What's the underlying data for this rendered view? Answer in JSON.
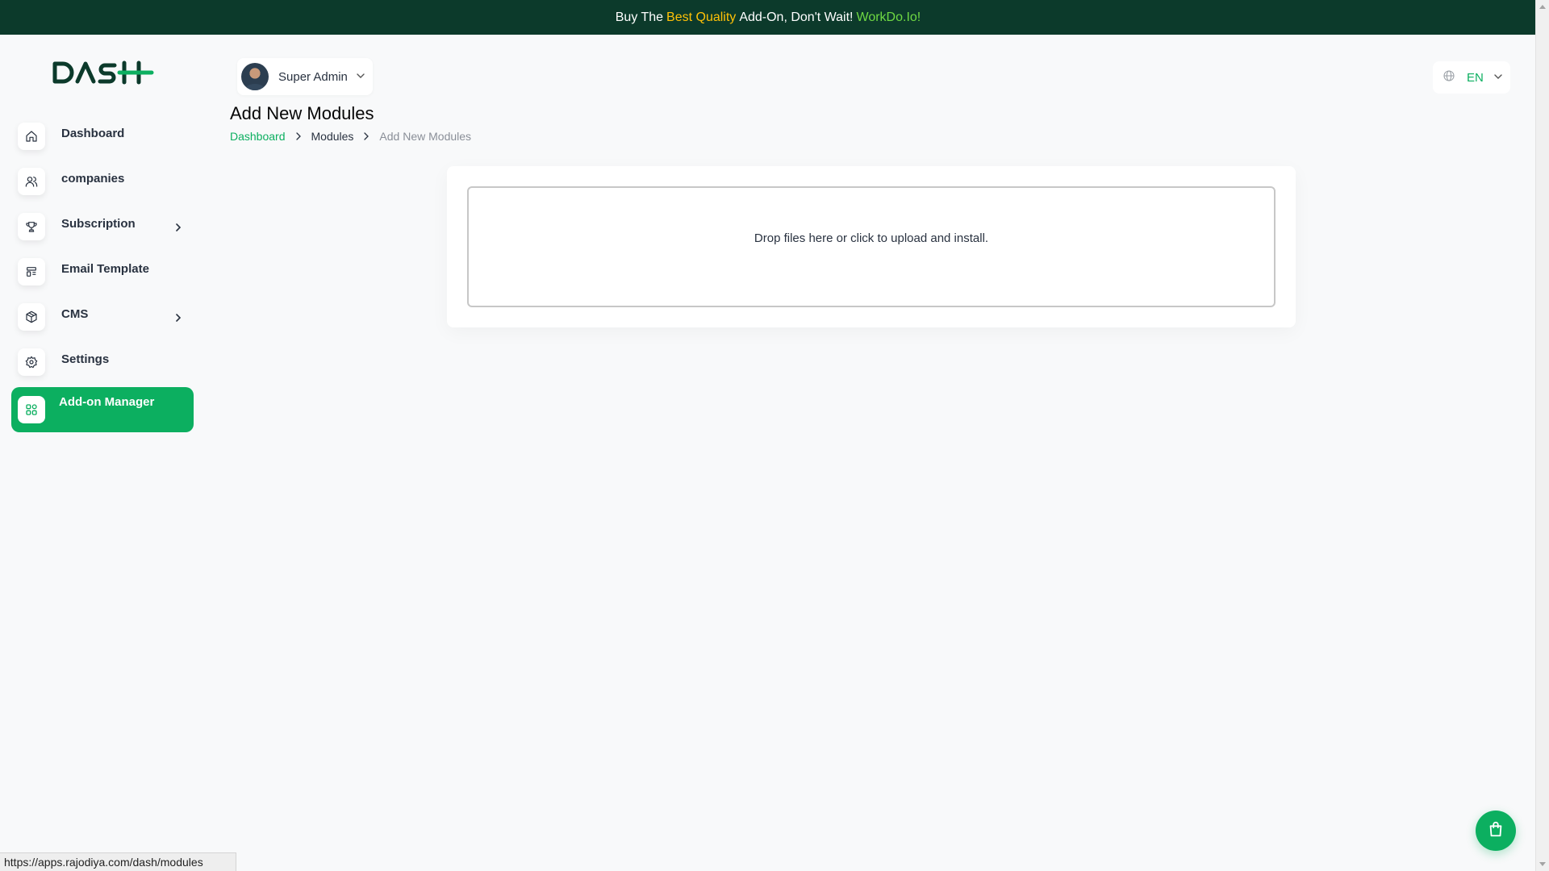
{
  "promo": {
    "prefix": "Buy The",
    "highlight": "Best Quality",
    "middle": "Add-On, Don't Wait!",
    "link": "WorkDo.Io!"
  },
  "brand": {
    "logo_text": "DASH"
  },
  "user": {
    "name": "Super Admin"
  },
  "language": {
    "code": "EN"
  },
  "sidebar": {
    "items": [
      {
        "label": "Dashboard",
        "icon": "home-icon"
      },
      {
        "label": "companies",
        "icon": "users-icon"
      },
      {
        "label": "Subscription",
        "icon": "trophy-icon",
        "has_submenu": true
      },
      {
        "label": "Email Template",
        "icon": "template-icon"
      },
      {
        "label": "CMS",
        "icon": "package-icon",
        "has_submenu": true
      },
      {
        "label": "Settings",
        "icon": "gear-icon"
      },
      {
        "label": "Add-on Manager",
        "icon": "grid-icon",
        "active": true
      }
    ]
  },
  "page": {
    "title": "Add New Modules",
    "breadcrumb": [
      "Dashboard",
      "Modules",
      "Add New Modules"
    ]
  },
  "upload": {
    "message": "Drop files here or click to upload and install."
  },
  "status_bar": {
    "url": "https://apps.rajodiya.com/dash/modules"
  },
  "colors": {
    "accent": "#0caf60",
    "promo_bg": "#0c3a2b",
    "promo_highlight": "#ffc107",
    "promo_link": "#6fd943"
  }
}
